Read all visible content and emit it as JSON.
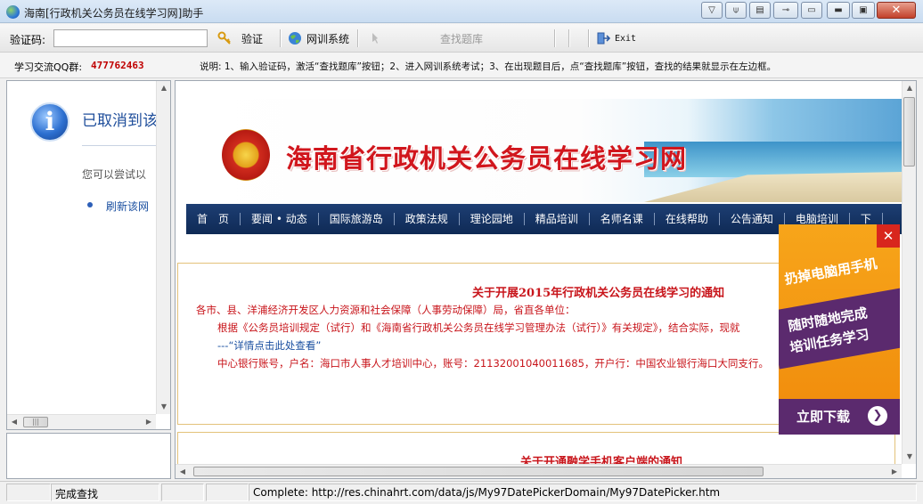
{
  "window": {
    "title": "海南[行政机关公务员在线学习网]助手",
    "controls": [
      "▽",
      "⍦",
      "▤",
      "⊸",
      "▭",
      "▬",
      "▣",
      "✕"
    ]
  },
  "toolbar": {
    "code_label": "验证码:",
    "code_value": "",
    "verify_label": "验证",
    "training_label": "网训系统",
    "search_label": "查找题库",
    "exit_label": "Exit"
  },
  "info": {
    "qq_label": "学习交流QQ群:",
    "qq_number": "477762463",
    "instructions": "说明: 1、输入验证码，激活“查找题库”按钮；2、进入网训系统考试；3、在出现题目后，点“查找题库”按钮，查找的结果就显示在左边框。"
  },
  "left_pane": {
    "heading": "已取消到该",
    "hint": "您可以尝试以",
    "refresh_link": "刷新该网"
  },
  "browser": {
    "site_title": "海南省行政机关公务员在线学习网",
    "nav": [
      "首　页",
      "要闻 • 动态",
      "国际旅游岛",
      "政策法规",
      "理论园地",
      "精品培训",
      "名师名课",
      "在线帮助",
      "公告通知",
      "电脑培训",
      "下"
    ],
    "notice": {
      "title": "关于开展2015年行政机关公务员在线学习的通知",
      "line1": "各市、县、洋浦经济开发区人力资源和社会保障（人事劳动保障）局，省直各单位：",
      "line2": "根据《公务员培训规定（试行）和《海南省行政机关公务员在线学习管理办法（试行）》有关规定》，结合实际，现就",
      "link": "---“详情点击此处查看”",
      "line3": "中心银行账号，户名：海口市人事人才培训中心，账号：21132001040011685，开户行：中国农业银行海口大同支行。"
    },
    "notice2_title": "关于开通融学手机客户端的通知"
  },
  "ad": {
    "close": "✕",
    "line1": "扔掉电脑用手机",
    "line2": "随时随地完成",
    "line3": "培训任务学习",
    "download": "立即下载",
    "go": "❯"
  },
  "status": {
    "left": "完成查找",
    "url": "Complete: http://res.chinahrt.com/data/js/My97DatePickerDomain/My97DatePicker.htm"
  }
}
